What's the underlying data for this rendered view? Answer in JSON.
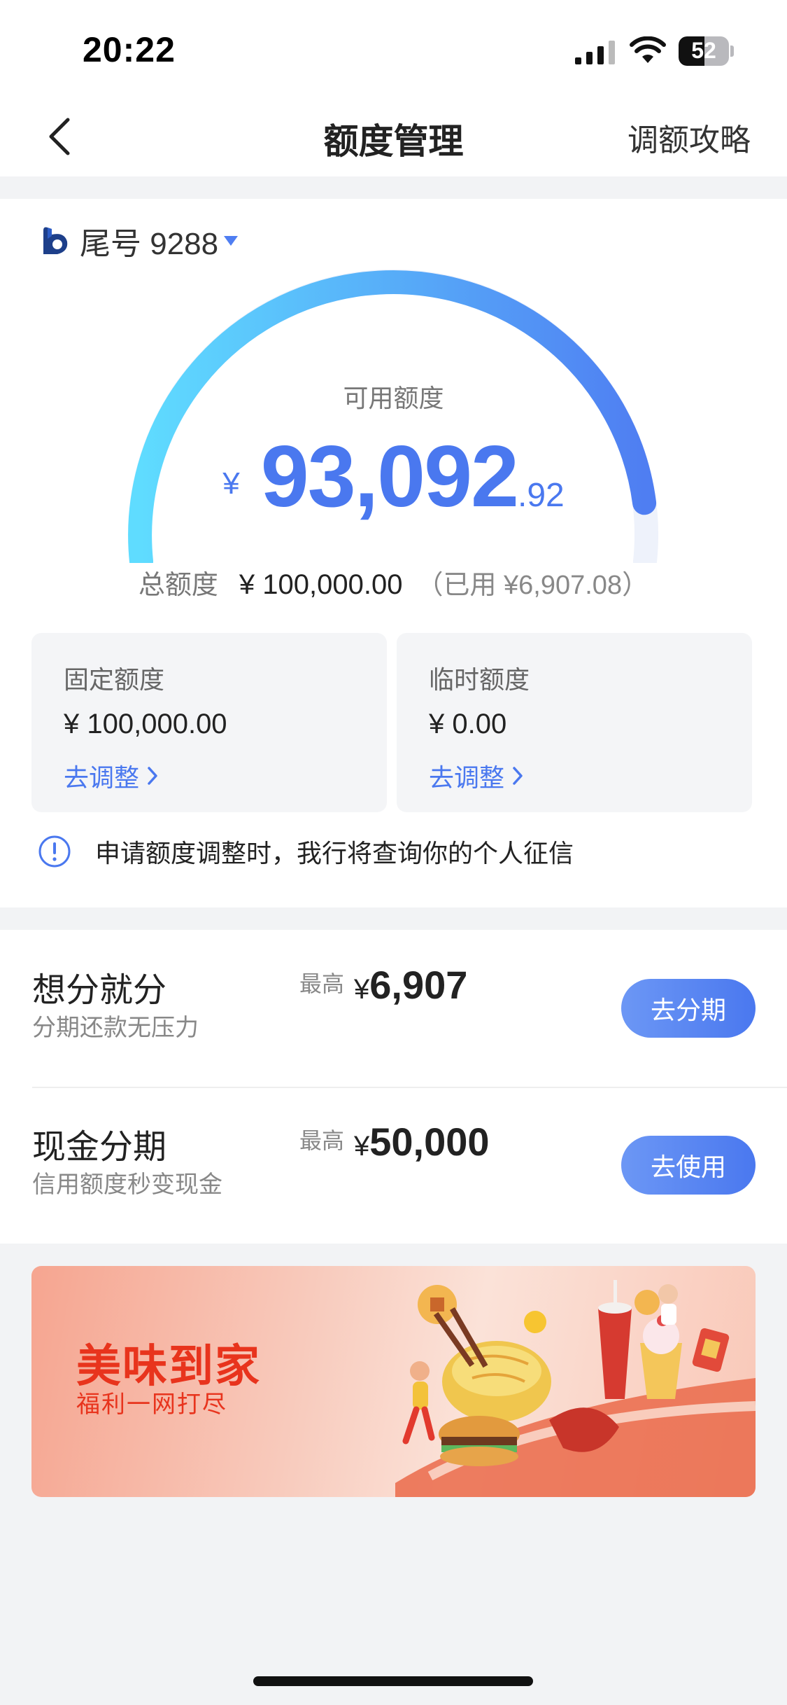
{
  "status_bar": {
    "time": "20:22",
    "battery_level": "52",
    "battery_fraction": 0.52
  },
  "nav": {
    "title": "额度管理",
    "right_link": "调额攻略",
    "back_icon": "chevron-left-icon"
  },
  "card": {
    "selector_label": "尾号 9288",
    "available": {
      "label": "可用额度",
      "currency": "¥",
      "integer": "93,092",
      "decimal": ".92"
    },
    "gauge_fraction_used": 0.069,
    "total": {
      "label": "总额度",
      "value": "¥ 100,000.00",
      "used": "（已用 ¥6,907.08）"
    },
    "fixed": {
      "title": "固定额度",
      "value": "¥ 100,000.00",
      "link": "去调整"
    },
    "temp": {
      "title": "临时额度",
      "value": "¥ 0.00",
      "link": "去调整"
    },
    "notice": "申请额度调整时，我行将查询你的个人征信"
  },
  "installments": [
    {
      "title": "想分就分",
      "subtitle": "分期还款无压力",
      "max_label": "最高",
      "currency": "¥",
      "amount": "6,907",
      "button": "去分期"
    },
    {
      "title": "现金分期",
      "subtitle": "信用额度秒变现金",
      "max_label": "最高",
      "currency": "¥",
      "amount": "50,000",
      "button": "去使用"
    }
  ],
  "banner": {
    "title": "美味到家",
    "subtitle": "福利一网打尽"
  },
  "colors": {
    "accent": "#4a78ef",
    "gauge_start": "#5fdcff",
    "gauge_end": "#4f7ef2",
    "banner_red": "#e8341d"
  }
}
